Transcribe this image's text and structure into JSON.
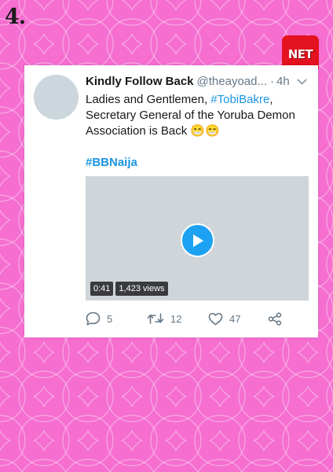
{
  "page": {
    "list_number": "4."
  },
  "brand": {
    "logo_text": "NET",
    "color": "#e4121f"
  },
  "tweet": {
    "display_name": "Kindly Follow Back",
    "handle": "@theayoad...",
    "separator": "·",
    "time": "4h",
    "text_lines": [
      {
        "before": "Ladies and Gentlemen, ",
        "link": "#TobiBakre",
        "after": ","
      },
      {
        "text": "Secretary General of the Yoruba Demon"
      },
      {
        "text": "Association is Back 😁😁"
      }
    ],
    "hashtag": "#BBNaija",
    "video": {
      "duration": "0:41",
      "views": "1,423 views"
    },
    "actions": {
      "replies": "5",
      "retweets": "12",
      "likes": "47"
    },
    "colors": {
      "link": "#1b95e0",
      "text": "#14171a",
      "muted": "#657786",
      "play": "#1da1f2"
    },
    "icons": [
      "chevron-down-icon",
      "play-icon",
      "reply-icon",
      "retweet-icon",
      "heart-icon",
      "share-icon"
    ]
  },
  "background": {
    "color": "#f56ed0",
    "pattern": "overlapping circles"
  }
}
